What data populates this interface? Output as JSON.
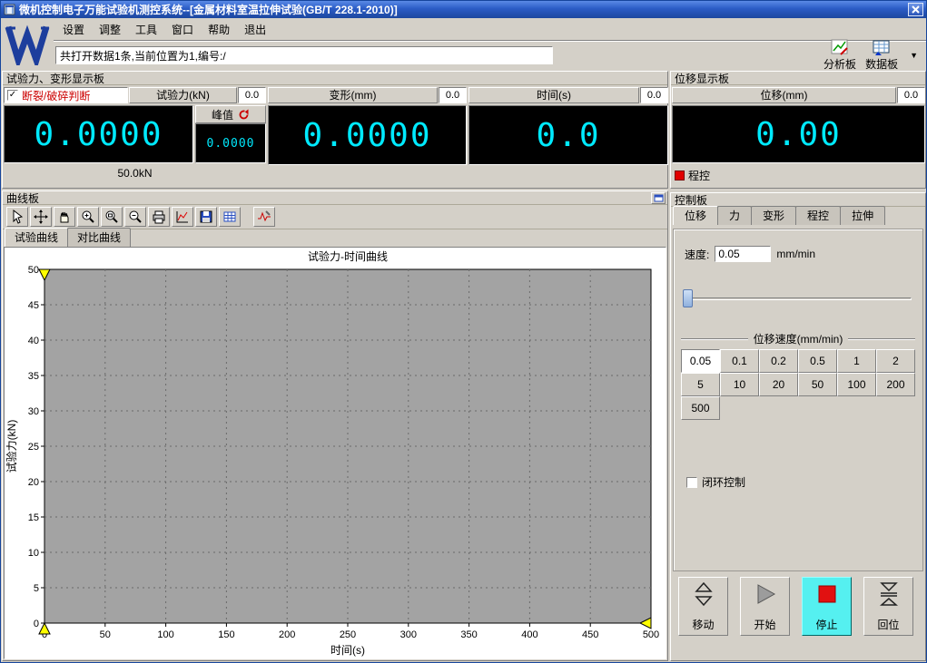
{
  "window": {
    "title": "微机控制电子万能试验机测控系统--[金属材料室温拉伸试验(GB/T 228.1-2010)]"
  },
  "menu": {
    "items": [
      "设置",
      "调整",
      "工具",
      "窗口",
      "帮助",
      "退出"
    ]
  },
  "toolbar": {
    "status_text": "共打开数据1条,当前位置为1,编号:/",
    "analysis_label": "分析板",
    "data_label": "数据板"
  },
  "force_panel": {
    "title": "试验力、变形显示板",
    "break_check_label": "断裂/破碎判断",
    "break_checked": "✓",
    "force_label": "试验力(kN)",
    "force_header_value": "0.0",
    "force_value": "0.0000",
    "peak_label": "峰值",
    "peak_value": "0.0000",
    "range_label": "50.0kN",
    "deform_label": "变形(mm)",
    "deform_header_value": "0.0",
    "deform_value": "0.0000",
    "time_label": "时间(s)",
    "time_header_value": "0.0",
    "time_value": "0.0"
  },
  "displacement_panel": {
    "title": "位移显示板",
    "label": "位移(mm)",
    "header_value": "0.0",
    "value": "0.00",
    "mode_label": "程控"
  },
  "curve_panel": {
    "title": "曲线板",
    "tabs": [
      "试验曲线",
      "对比曲线"
    ],
    "active_tab": "试验曲线"
  },
  "chart_data": {
    "type": "line",
    "title": "试验力-时间曲线",
    "xlabel": "时间(s)",
    "ylabel": "试验力(kN)",
    "xlim": [
      0,
      500
    ],
    "ylim": [
      0,
      50
    ],
    "x_ticks": [
      0,
      50,
      100,
      150,
      200,
      250,
      300,
      350,
      400,
      450,
      500
    ],
    "y_ticks": [
      0,
      5,
      10,
      15,
      20,
      25,
      30,
      35,
      40,
      45,
      50
    ],
    "grid": true,
    "plot_background": "#a3a3a3",
    "series": []
  },
  "control_panel": {
    "title": "控制板",
    "tabs": [
      "位移",
      "力",
      "变形",
      "程控",
      "拉伸"
    ],
    "active_tab": "位移",
    "speed_label": "速度:",
    "speed_value": "0.05",
    "speed_unit": "mm/min",
    "group_title": "位移速度(mm/min)",
    "speed_options": [
      "0.05",
      "0.1",
      "0.2",
      "0.5",
      "1",
      "2",
      "5",
      "10",
      "20",
      "50",
      "100",
      "200",
      "500"
    ],
    "active_speed": "0.05",
    "closed_loop_label": "闭环控制",
    "buttons": [
      {
        "label": "移动"
      },
      {
        "label": "开始"
      },
      {
        "label": "停止",
        "active": true
      },
      {
        "label": "回位"
      }
    ]
  },
  "colors": {
    "digit": "#00eaff",
    "alert_red": "#cc0000",
    "stop_active_bg": "#55f0f0",
    "plot_bg": "#a3a3a3"
  }
}
